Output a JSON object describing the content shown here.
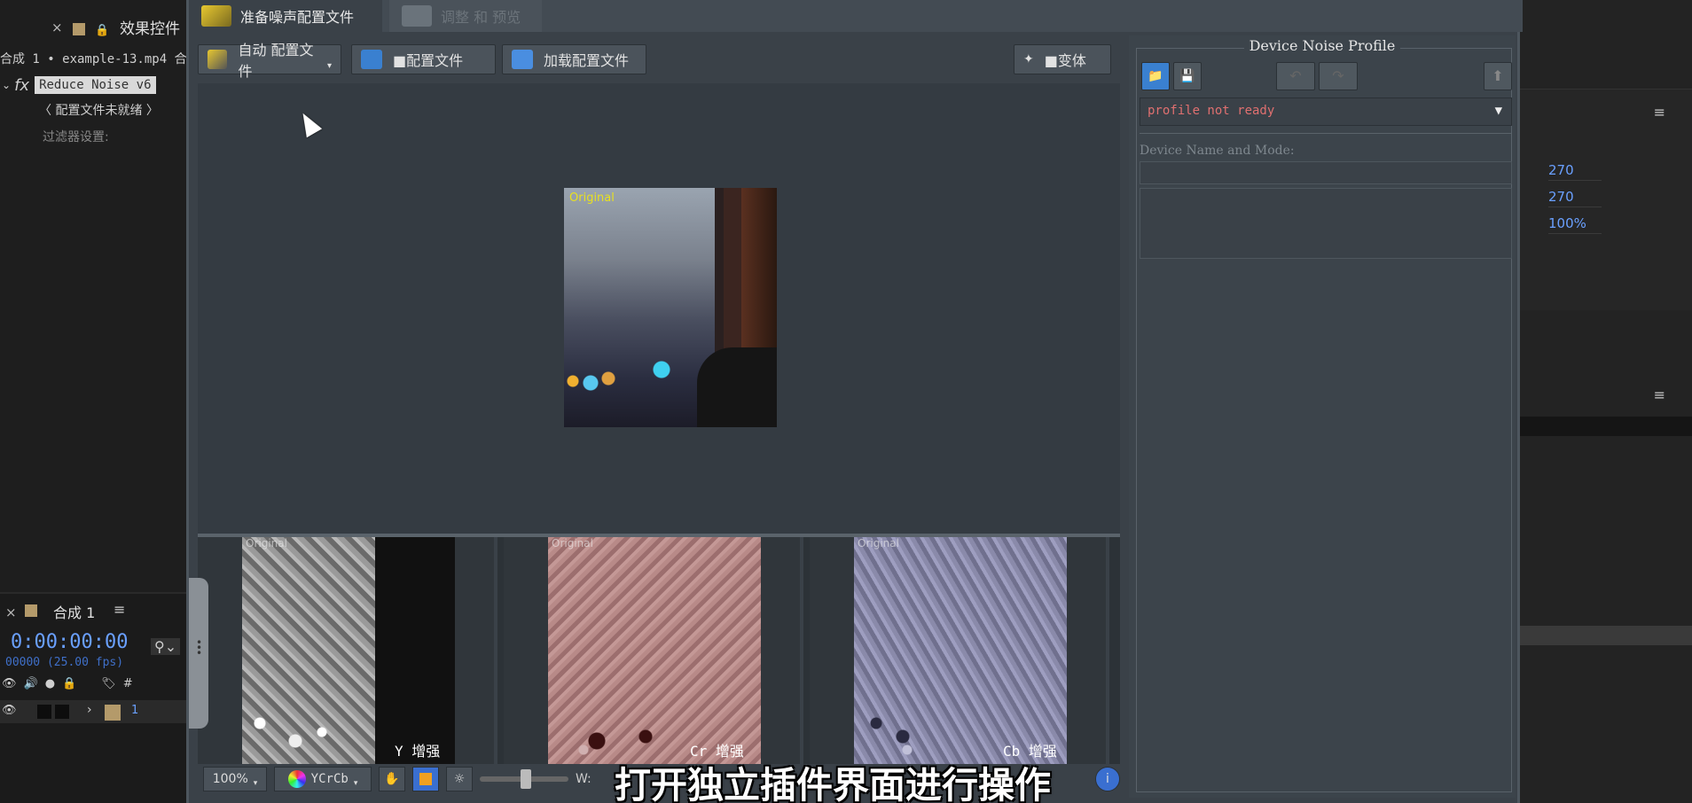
{
  "host": {
    "effects_tab_label": "效果控件",
    "comp_line": "合成 1 • example-13.mp4 合",
    "effect_name": "Reduce Noise v6",
    "profile_status": "〈 配置文件未就绪 〉",
    "filter_settings": "过滤器设置:",
    "timeline_tab": "合成 1",
    "timecode": "0:00:00:00",
    "fps": "00000 (25.00 fps)",
    "layer_number": "1",
    "col_hash": "#",
    "right_values": [
      "270",
      "270",
      "100%"
    ]
  },
  "plugin": {
    "tabs": [
      {
        "label": "准备噪声配置文件"
      },
      {
        "label": "调整 和 预览"
      }
    ],
    "toolbar": {
      "auto_profile": "自动 配置文件",
      "profile": "■配置文件",
      "load_profile": "加载配置文件",
      "variant": "■变体"
    },
    "preview": {
      "original_label": "Original"
    },
    "channels": [
      {
        "orig": "Original",
        "label": "Y 增强"
      },
      {
        "orig": "Original",
        "label": "Cr 增强"
      },
      {
        "orig": "Original",
        "label": "Cb 增强"
      }
    ],
    "statusbar": {
      "zoom": "100%",
      "colorspace": "YCrCb",
      "w_label": "W:"
    }
  },
  "profile_panel": {
    "title": "Device Noise Profile",
    "dropdown_value": "profile not ready",
    "device_label": "Device Name and Mode:"
  },
  "subtitle": "打开独立插件界面进行操作",
  "colors": {
    "accent_blue": "#6aa0ff",
    "warning_red": "#e07070",
    "label_yellow": "#e8e020"
  }
}
